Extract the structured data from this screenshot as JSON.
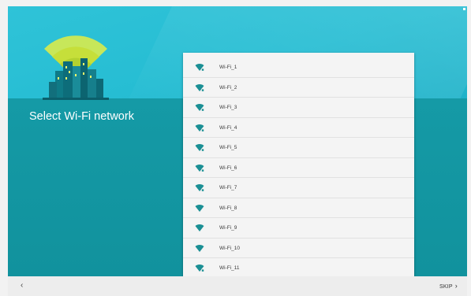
{
  "header": {
    "title": "Select Wi-Fi network"
  },
  "networks": [
    {
      "name": "Wi-Fi_1",
      "icon": "wifi-secured-icon"
    },
    {
      "name": "Wi-Fi_2",
      "icon": "wifi-secured-icon"
    },
    {
      "name": "Wi-Fi_3",
      "icon": "wifi-secured-icon"
    },
    {
      "name": "Wi-Fi_4",
      "icon": "wifi-secured-icon"
    },
    {
      "name": "Wi-Fi_5",
      "icon": "wifi-secured-icon"
    },
    {
      "name": "Wi-Fi_6",
      "icon": "wifi-secured-icon"
    },
    {
      "name": "Wi-Fi_7",
      "icon": "wifi-secured-icon"
    },
    {
      "name": "Wi-Fi_8",
      "icon": "wifi-icon"
    },
    {
      "name": "Wi-Fi_9",
      "icon": "wifi-icon"
    },
    {
      "name": "Wi-Fi_10",
      "icon": "wifi-icon"
    },
    {
      "name": "Wi-Fi_11",
      "icon": "wifi-secured-icon"
    }
  ],
  "footer": {
    "back_label": "‹",
    "skip_label": "SKIP",
    "skip_chevron": "›"
  },
  "colors": {
    "header": "#26bdd3",
    "body": "#11949f",
    "wifi_icon": "#1a8f94",
    "wifi_beam": "#d7e94a"
  }
}
